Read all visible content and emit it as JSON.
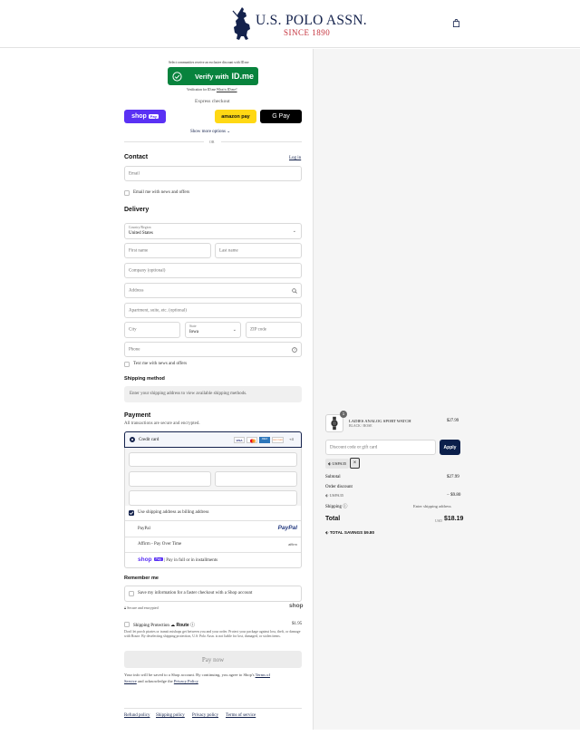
{
  "header": {
    "brand": "U.S. POLO ASSN.",
    "since": "SINCE 1890"
  },
  "idme": {
    "promo": "Select communities receive an exclusive discount with ID.me",
    "verify_label": "Verify with",
    "idme_logo": "ID.me",
    "note": "Verification for ID.me",
    "what_link": "What is ID.me?"
  },
  "express": {
    "title": "Express checkout",
    "shop_pay": "shop",
    "shop_pay_badge": "Pay",
    "amazon_pay": "amazon pay",
    "google_pay": "G Pay",
    "show_more": "Show more options",
    "or": "OR"
  },
  "contact": {
    "title": "Contact",
    "login": "Log in",
    "email_placeholder": "Email",
    "news_label": "Email me with news and offers"
  },
  "delivery": {
    "title": "Delivery",
    "country_label": "Country/Region",
    "country_value": "United States",
    "first_name": "First name",
    "last_name": "Last name",
    "company": "Company (optional)",
    "address": "Address",
    "apartment": "Apartment, suite, etc. (optional)",
    "city": "City",
    "state_label": "State",
    "state_value": "Iowa",
    "zip": "ZIP code",
    "phone": "Phone",
    "text_news": "Text me with news and offers"
  },
  "shipping_method": {
    "title": "Shipping method",
    "message": "Enter your shipping address to view available shipping methods."
  },
  "payment": {
    "title": "Payment",
    "subtitle": "All transactions are secure and encrypted.",
    "credit_card": "Credit card",
    "card_brands": [
      "VISA",
      "MC",
      "AMEX",
      "DISCOVER"
    ],
    "more_cards": "+4",
    "billing_same": "Use shipping address as billing address",
    "paypal": "PayPal",
    "paypal_logo": "PayPal",
    "affirm": "Affirm - Pay Over Time",
    "affirm_logo": "affirm",
    "shop_pay_installments": "| Pay in full or in installments",
    "shop_pay_logo": "shop",
    "shop_pay_badge": "Pay"
  },
  "remember": {
    "title": "Remember me",
    "save_info": "Save my information for a faster checkout with a Shop account",
    "secure": "Secure and encrypted",
    "shop_logo": "shop"
  },
  "protection": {
    "title": "Shipping Protection",
    "route": "Route",
    "price": "$1.95",
    "description": "Don't let porch pirates or transit mishaps get between you and your order. Protect your package against loss, theft, or damage with Route. By deselecting shipping protection, U.S. Polo Assn. is not liable for lost, damaged, or stolen items."
  },
  "pay_now": "Pay now",
  "terms": {
    "line1": "Your info will be saved to a Shop account. By continuing, you agree to Shop's ",
    "terms_link": "Terms of",
    "terms_link2": "Service",
    "line2": " and acknowledge the ",
    "privacy_link": "Privacy Policy"
  },
  "footer_links": [
    "Refund policy",
    "Shipping policy",
    "Privacy policy",
    "Terms of service"
  ],
  "summary": {
    "item_name": "LADIES ANALOG SPORT WATCH",
    "item_variant": "BLACK / ROSE",
    "item_qty": "1",
    "item_price": "$27.99",
    "discount_placeholder": "Discount code or gift card",
    "apply": "Apply",
    "code_chip": "USPA35",
    "subtotal_label": "Subtotal",
    "subtotal": "$27.99",
    "order_discount_label": "Order discount",
    "code": "USPA35",
    "discount": "− $9.80",
    "shipping_label": "Shipping",
    "shipping_value": "Enter shipping address",
    "total_label": "Total",
    "currency": "USD",
    "total": "$18.19",
    "savings_label": "TOTAL SAVINGS",
    "savings": "$9.80"
  },
  "colors": {
    "navy": "#14224c",
    "red": "#c5303b",
    "idme_green": "#08833d",
    "shop_purple": "#5a31f4",
    "amazon_yellow": "#ffd814",
    "apply_navy": "#0b1f4b"
  }
}
